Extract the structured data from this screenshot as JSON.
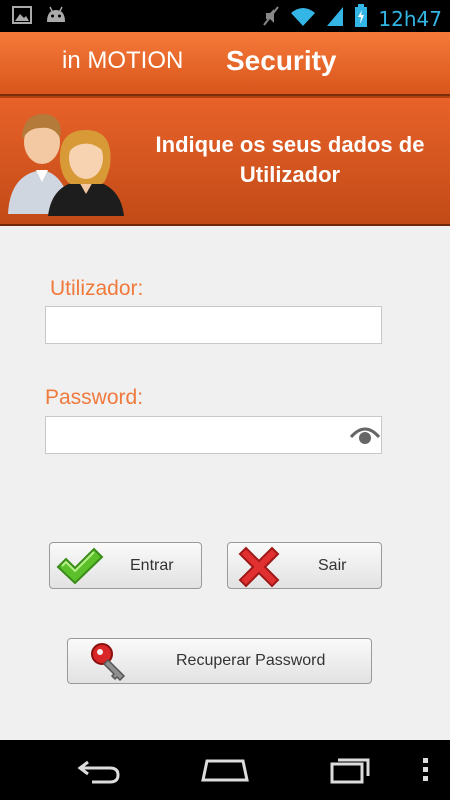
{
  "status_bar": {
    "time": "12h47",
    "icons": [
      "picture-icon",
      "android-icon",
      "mute-icon",
      "wifi-icon",
      "signal-icon",
      "battery-charging-icon"
    ]
  },
  "header": {
    "app_name": "in MOTION",
    "title": "Security"
  },
  "banner": {
    "line1": "Indique os seus dados de",
    "line2": "Utilizador",
    "icon": "users-icon"
  },
  "form": {
    "username_label": "Utilizador:",
    "username_value": "",
    "password_label": "Password:",
    "password_value": "",
    "password_toggle_icon": "eye-icon"
  },
  "buttons": {
    "enter_label": "Entrar",
    "enter_icon": "checkmark-icon",
    "exit_label": "Sair",
    "exit_icon": "x-icon",
    "recover_label": "Recuperar Password",
    "recover_icon": "key-icon"
  },
  "nav_bar": {
    "icons": [
      "back-icon",
      "home-icon",
      "recent-apps-icon",
      "menu-icon"
    ]
  },
  "colors": {
    "accent": "#e8622a",
    "label": "#f07a3c",
    "status_text": "#33b5e5"
  }
}
